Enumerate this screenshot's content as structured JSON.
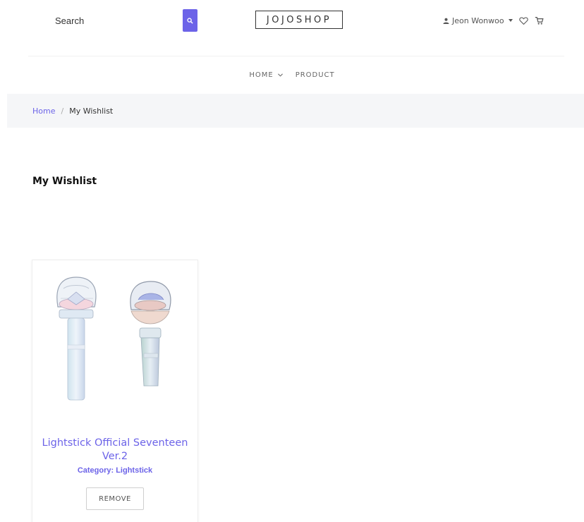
{
  "header": {
    "search_placeholder": "Search",
    "logo_text": "JOJOSHOP",
    "user_name": "Jeon Wonwoo",
    "accent_color": "#6c63e8"
  },
  "nav": {
    "items": [
      {
        "label": "HOME",
        "has_dropdown": true
      },
      {
        "label": "PRODUCT",
        "has_dropdown": false
      }
    ]
  },
  "breadcrumb": {
    "home": "Home",
    "separator": "/",
    "current": "My Wishlist"
  },
  "page": {
    "title": "My Wishlist"
  },
  "wishlist": {
    "items": [
      {
        "name": "Lightstick Official Seventeen Ver.2",
        "category": "Category: Lightstick",
        "remove_label": "REMOVE",
        "image_icon": "lightstick-image"
      }
    ]
  },
  "icons": {
    "search": "search-icon",
    "user": "user-icon",
    "wishlist": "heart-icon",
    "cart": "cart-icon"
  }
}
